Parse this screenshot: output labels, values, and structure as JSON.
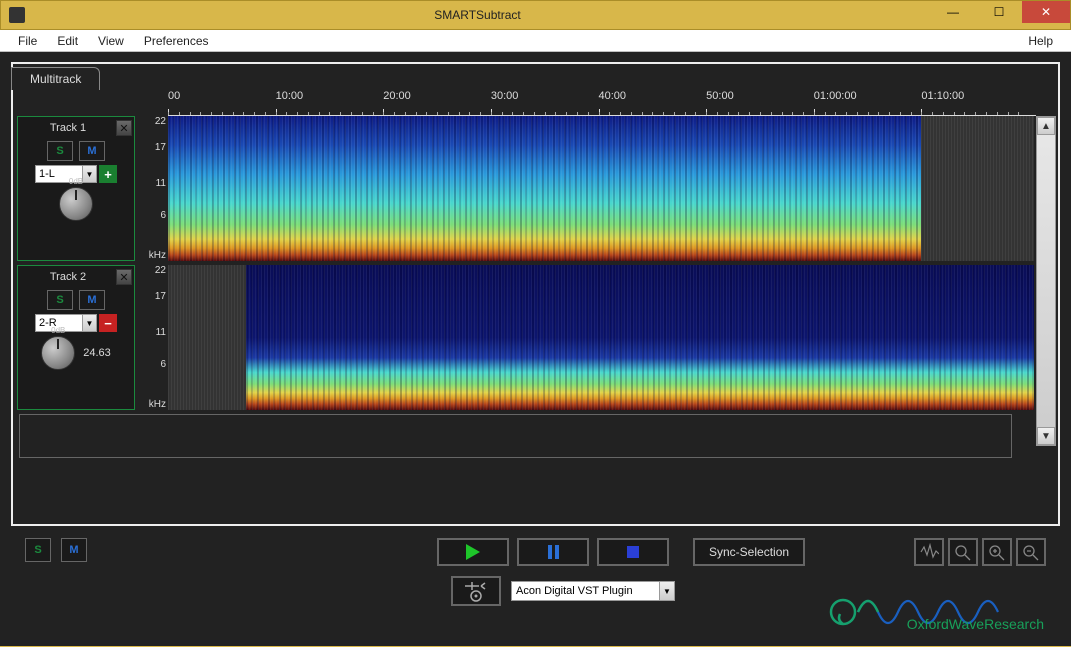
{
  "window": {
    "title": "SMARTSubtract"
  },
  "menu": {
    "file": "File",
    "edit": "Edit",
    "view": "View",
    "prefs": "Preferences",
    "help": "Help"
  },
  "tab": {
    "label": "Multitrack"
  },
  "timeRuler": {
    "ticks": [
      "00",
      "10:00",
      "20:00",
      "30:00",
      "40:00",
      "50:00",
      "01:00:00",
      "01:10:00"
    ]
  },
  "freqAxis": {
    "ticks": [
      "22",
      "17",
      "11",
      "6"
    ],
    "unit": "kHz"
  },
  "tracks": [
    {
      "name": "Track 1",
      "channel": "1-L",
      "sign": "+",
      "knobLabel": "0dB",
      "readout": ""
    },
    {
      "name": "Track 2",
      "channel": "2-R",
      "sign": "−",
      "knobLabel": "0dB",
      "readout": "24.63"
    }
  ],
  "transport": {
    "sync": "Sync-Selection"
  },
  "plugin": {
    "selected": "Acon Digital VST Plugin"
  },
  "brand": {
    "text": "OxfordWaveResearch"
  }
}
